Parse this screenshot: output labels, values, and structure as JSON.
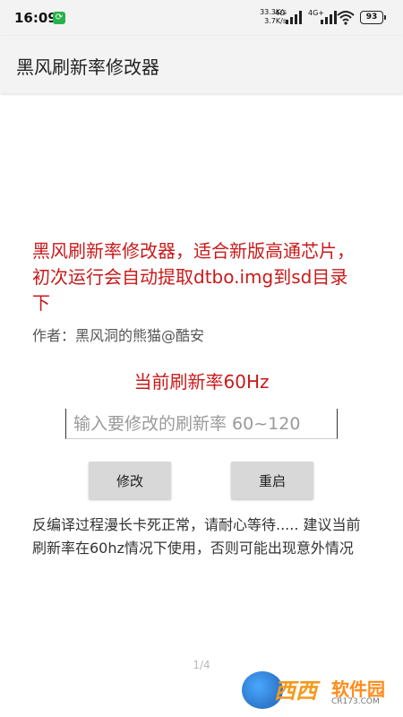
{
  "status_bar": {
    "time": "16:09",
    "net_speed_up": "33.3K/s",
    "net_speed_down": "3.7K/s",
    "net_type_1": "4G",
    "net_type_2": "4G+",
    "battery": "93"
  },
  "app_bar": {
    "title": "黑风刷新率修改器"
  },
  "main": {
    "intro": "黑风刷新率修改器，适合新版高通芯片，初次运行会自动提取dtbo.img到sd目录下",
    "author": "作者：黑风洞的熊猫@酷安",
    "current_rate": "当前刷新率60Hz",
    "input_placeholder": "输入要修改的刷新率 60~120",
    "input_value": "",
    "modify_label": "修改",
    "restart_label": "重启",
    "note": "反编译过程漫长卡死正常，请耐心等待..... 建议当前刷新率在60hz情况下使用，否则可能出现意外情况"
  },
  "pager": "1/4",
  "watermark": {
    "brand": "西西",
    "sub": "软件园",
    "url": "CR173.COM"
  },
  "colors": {
    "accent_red": "#c81a1a",
    "button_bg": "#d8d8d8",
    "bar_bg": "#f3f3f3"
  }
}
